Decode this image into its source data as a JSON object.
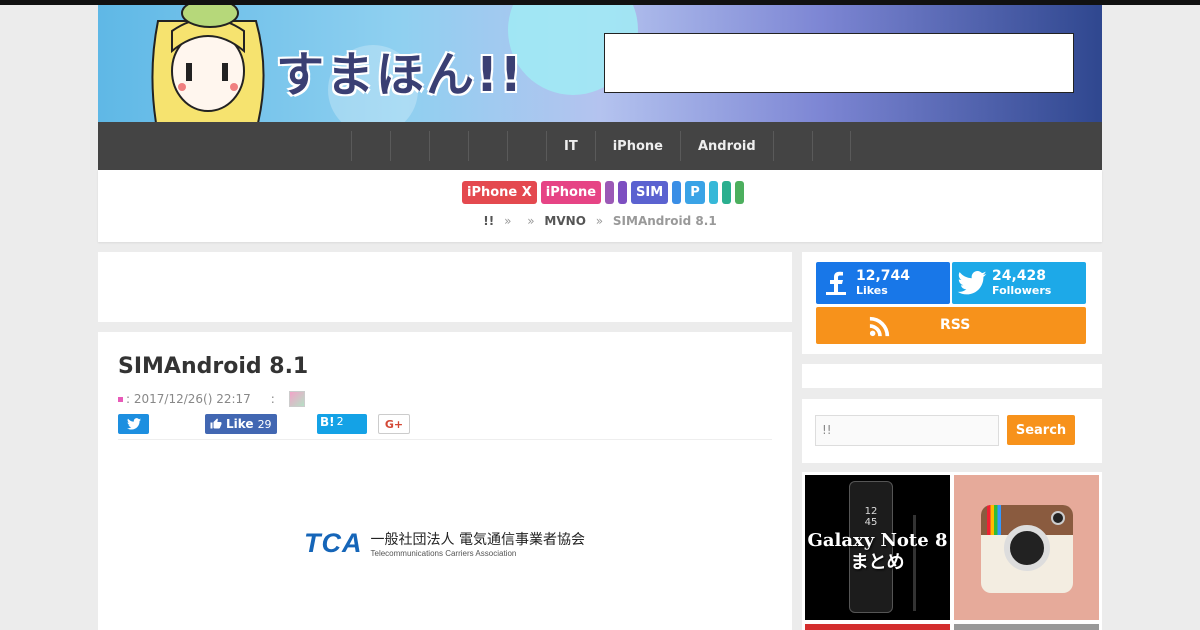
{
  "header": {
    "logo_text": "すまほん!!"
  },
  "nav": {
    "items": [
      "",
      "",
      "",
      "",
      "",
      "IT",
      "iPhone",
      "Android",
      "",
      ""
    ]
  },
  "tags": [
    {
      "label": "iPhone X",
      "color": "#e4494f"
    },
    {
      "label": "iPhone",
      "color": "#e64485"
    },
    {
      "label": "",
      "color": "#9b59b6"
    },
    {
      "label": "",
      "color": "#7d4fc1"
    },
    {
      "label": "SIM",
      "color": "#5b62d0"
    },
    {
      "label": "",
      "color": "#3a8ee6"
    },
    {
      "label": "P",
      "color": "#3aa3e6"
    },
    {
      "label": "",
      "color": "#36b8d8"
    },
    {
      "label": "",
      "color": "#2aaf8f"
    },
    {
      "label": "",
      "color": "#4caf5e"
    }
  ],
  "breadcrumb": {
    "home": "!!",
    "sep": "»",
    "level2": "",
    "level3": "MVNO",
    "current": "SIMAndroid 8.1"
  },
  "article": {
    "title": "SIMAndroid 8.1",
    "date": ": 2017/12/26() 22:17",
    "author_label": ":",
    "share": {
      "like_label": "Like",
      "like_count": "29",
      "hatena_label": "B!",
      "hatena_count": "2",
      "gplus_label": "G+"
    },
    "image": {
      "logo": "TCA",
      "org_ja": "一般社団法人 電気通信事業者協会",
      "org_en": "Telecommunications Carriers Association"
    }
  },
  "sidebar": {
    "facebook": {
      "count": "12,744",
      "label": "Likes"
    },
    "twitter": {
      "count": "24,428",
      "label": "Followers"
    },
    "rss": {
      "label": "RSS"
    },
    "search": {
      "placeholder": "!!",
      "button": "Search"
    },
    "thumbs": {
      "note_caption_1": "Galaxy Note 8",
      "note_caption_2": "まとめ",
      "note_clock_1": "12",
      "note_clock_2": "45"
    }
  },
  "colors": {
    "accent_orange": "#f7921b",
    "facebook": "#1877e8",
    "twitter": "#1da9e8",
    "nav_bg": "#444444"
  }
}
